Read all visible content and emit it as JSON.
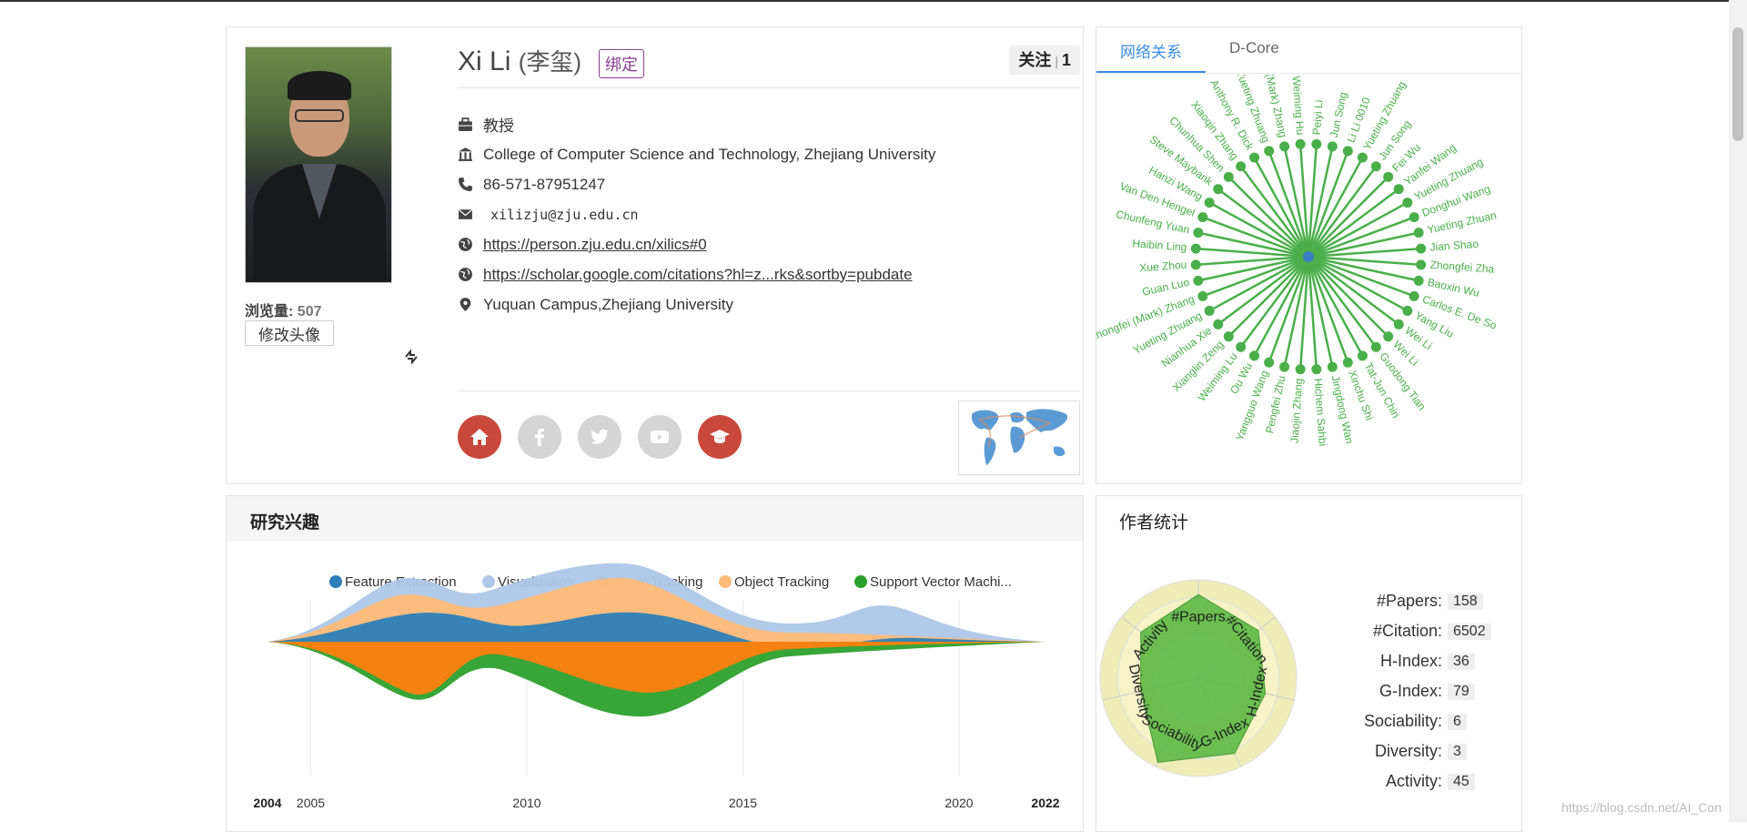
{
  "profile": {
    "name": "Xi Li",
    "name_cn": "(李玺)",
    "bind_label": "绑定",
    "follow_label": "关注",
    "follow_sep": "|",
    "follow_count": "1",
    "views_label": "浏览量:",
    "views_count": "507",
    "edit_photo_label": "修改头像",
    "title": "教授",
    "affiliation": "College of Computer Science and Technology, Zhejiang University",
    "phone": "86-571-87951247",
    "email": "xilizju@zju.edu.cn",
    "homepage": "https://person.zju.edu.cn/xilics#0",
    "scholar": "https://scholar.google.com/citations?hl=z...rks&sortby=pubdate",
    "address": "Yuquan Campus,Zhejiang University",
    "icons": [
      "briefcase-icon",
      "institution-icon",
      "phone-icon",
      "envelope-icon",
      "globe-icon",
      "globe-icon",
      "map-marker-icon"
    ],
    "social": [
      {
        "name": "home-icon",
        "color": "#c9483b"
      },
      {
        "name": "facebook-icon",
        "color": "#d5d5d5"
      },
      {
        "name": "twitter-icon",
        "color": "#d5d5d5"
      },
      {
        "name": "youtube-icon",
        "color": "#d5d5d5"
      },
      {
        "name": "graduation-cap-icon",
        "color": "#c9483b"
      }
    ]
  },
  "network": {
    "tabs": [
      "网络关系",
      "D-Core"
    ],
    "active_tab": 0,
    "center_color": "#3a7fc4",
    "node_color": "#4aaf4a",
    "nodes": [
      "Peiyi Li",
      "Jun Song",
      "Li Li 0010",
      "Yueting Zhuang",
      "Jun Song",
      "Fei Wu",
      "Yanfei Wang",
      "Yueting Zhuang",
      "Donghui Wang",
      "Yueting Zhuan",
      "Jian Shao",
      "Zhongfei Zha",
      "Baoxin Wu",
      "Carlos E. De So",
      "Yang Liu",
      "Wei Li",
      "Wei Li",
      "Guodong Tian",
      "Tat-Jun Chin",
      "Xinchu Shi",
      "Jingdong Wan",
      "Hichem Sahbi",
      "Jiaojin Zhang",
      "Pengfei Zhu",
      "Yangguo Wang",
      "Ou Wu",
      "Weiming Lu",
      "Xianglin Zeng",
      "Nianhua Xie",
      "Yueting Zhuang",
      "Zhongfei (Mark) Zhang",
      "Guan Luo",
      "Xue Zhou",
      "Haibin Ling",
      "Chunfeng Yuan",
      "Van Den Hengel",
      "Hanzi Wang",
      "Steve Maybank",
      "Chunhua Shen",
      "Xiaoqin Zhang",
      "Anthony R. Dick",
      "Yueting Zhuang",
      "Zhongfei (Mark) Zhang",
      "Weiming Hu"
    ]
  },
  "interests": {
    "title": "研究兴趣",
    "legend": [
      {
        "label": "Feature Extraction",
        "color": "#2c7fb8"
      },
      {
        "label": "Visualization",
        "color": "#aec7e8"
      },
      {
        "label": "Visual Tracking",
        "color": "#ff7f0e"
      },
      {
        "label": "Object Tracking",
        "color": "#ffbb78"
      },
      {
        "label": "Support Vector Machi...",
        "color": "#2ca02c"
      }
    ],
    "axis_start": "2004",
    "axis_end": "2022",
    "ticks": [
      "2005",
      "2010",
      "2015",
      "2020"
    ]
  },
  "stats": {
    "title": "作者统计",
    "radar_axes": [
      "#Papers",
      "#Citation",
      "H-Index",
      "G-Index",
      "Sociability",
      "Diversity",
      "Activity"
    ],
    "radar_levels": [
      0.85,
      0.78,
      0.7,
      0.85,
      0.95,
      0.6,
      0.75
    ],
    "fill_color": "#5cb842",
    "metrics": [
      {
        "label": "#Papers:",
        "value": "158"
      },
      {
        "label": "#Citation:",
        "value": "6502"
      },
      {
        "label": "H-Index:",
        "value": "36"
      },
      {
        "label": "G-Index:",
        "value": "79"
      },
      {
        "label": "Sociability:",
        "value": "6"
      },
      {
        "label": "Diversity:",
        "value": "3"
      },
      {
        "label": "Activity:",
        "value": "45"
      }
    ]
  },
  "watermark": "https://blog.csdn.net/AI_Con"
}
